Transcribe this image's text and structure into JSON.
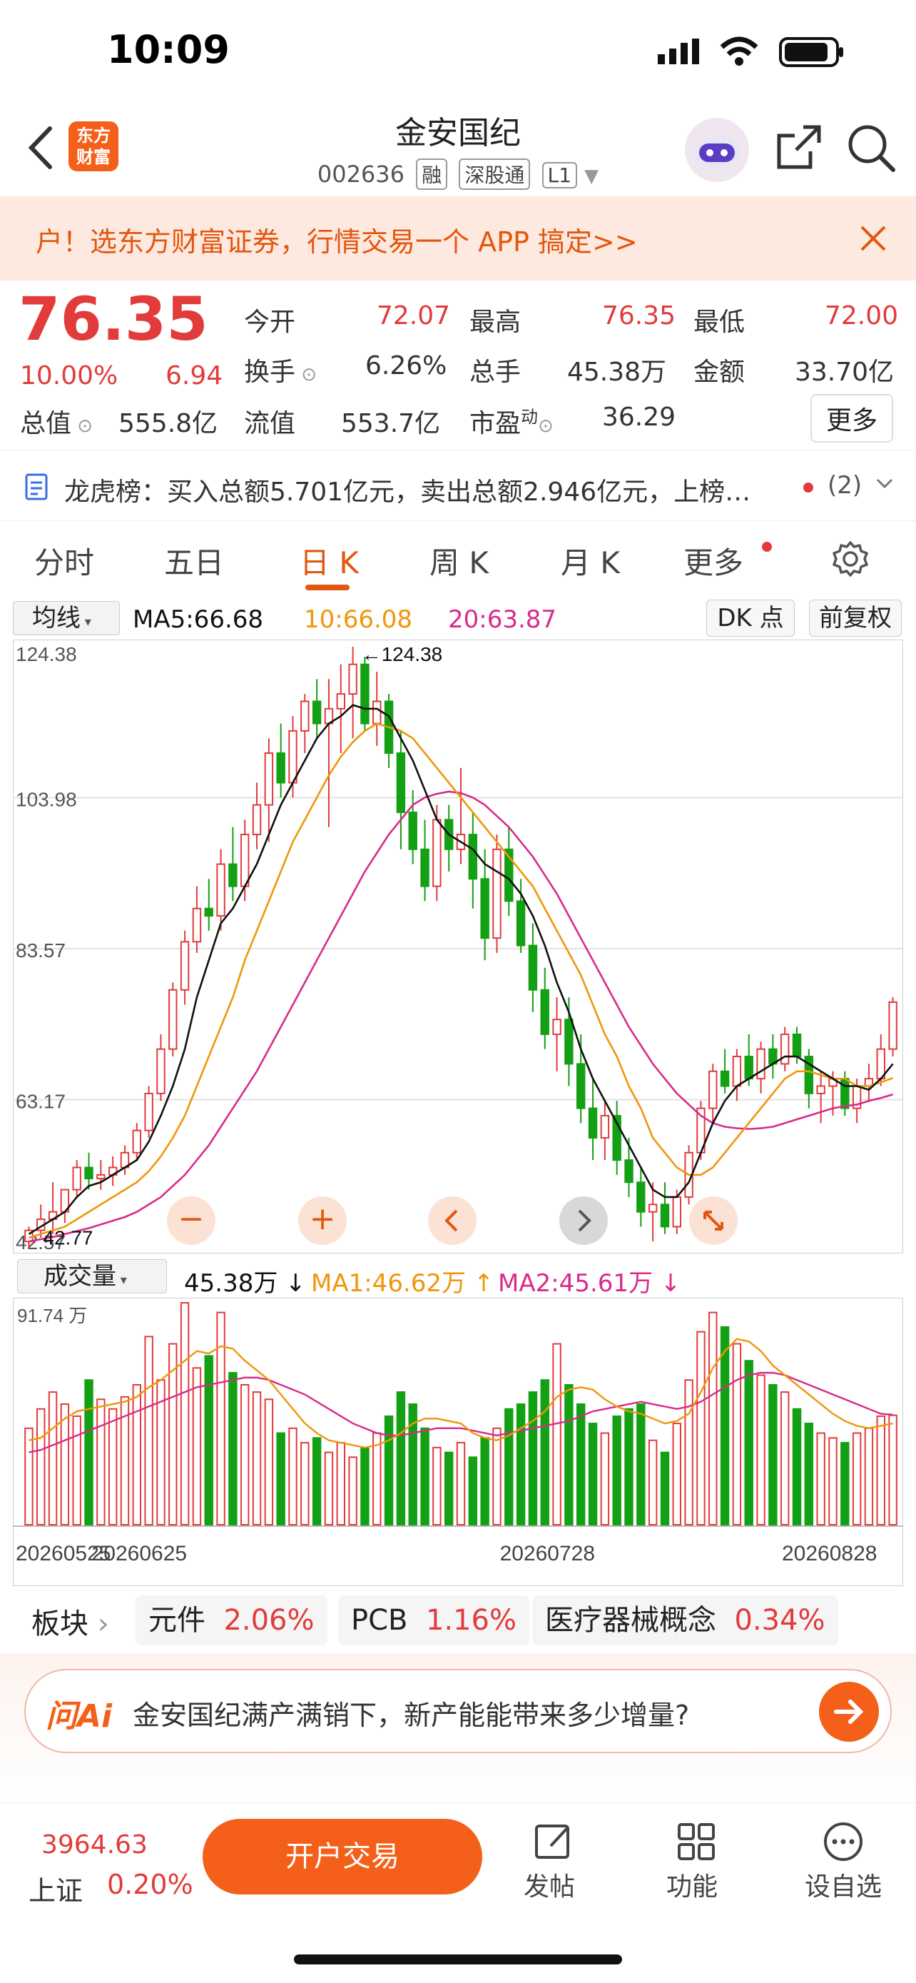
{
  "status": {
    "time": "10:09"
  },
  "header": {
    "brand_line1": "东方",
    "brand_line2": "财富",
    "title": "金安国纪",
    "code": "002636",
    "tags": [
      "融",
      "深股通",
      "L1"
    ]
  },
  "promo": {
    "text": "户！选东方财富证券，行情交易一个 APP 搞定>>"
  },
  "quote": {
    "price": "76.35",
    "change_pct": "10.00%",
    "change_amt": "6.94",
    "fields": [
      {
        "label": "今开",
        "value": "72.07"
      },
      {
        "label": "最高",
        "value": "76.35"
      },
      {
        "label": "最低",
        "value": "72.00"
      },
      {
        "label": "换手",
        "value": "6.26%"
      },
      {
        "label": "总手",
        "value": "45.38万"
      },
      {
        "label": "金额",
        "value": "33.70亿"
      },
      {
        "label": "总值",
        "value": "555.8亿"
      },
      {
        "label": "流值",
        "value": "553.7亿"
      },
      {
        "label": "市盈",
        "value": "36.29"
      }
    ],
    "pe_sup": "动",
    "more": "更多"
  },
  "lhb": {
    "text": "龙虎榜：买入总额5.701亿元，卖出总额2.946亿元，上榜…",
    "count": "(2)"
  },
  "tabs": [
    "分时",
    "五日",
    "日 K",
    "周 K",
    "月 K",
    "更多"
  ],
  "chart_controls": {
    "ma_selector": "均线",
    "ma5": "MA5:66.68",
    "ma10": "10:66.08",
    "ma20": "20:63.87",
    "dk": "DK 点",
    "adjust": "前复权",
    "vol_selector": "成交量",
    "vol_value": "45.38万",
    "vol_ma1": "MA1:46.62万",
    "vol_ma2": "MA2:45.61万",
    "vol_max": "91.74 万",
    "high_marker": "←124.38",
    "low_marker": "42.77"
  },
  "colors": {
    "up": "#e23b3b",
    "down": "#14a014",
    "ma5": "#111111",
    "ma10": "#f0960a",
    "ma20": "#d82b8a",
    "accent": "#f4601a"
  },
  "chart_data": {
    "type": "candlestick",
    "y_ticks": [
      "124.38",
      "103.98",
      "83.57",
      "63.17",
      "42.57"
    ],
    "ylim": [
      42.57,
      124.38
    ],
    "x_ticks": [
      "20260525",
      "20260625",
      "20260728",
      "20260828"
    ],
    "candles": [
      [
        44,
        46,
        43,
        45.5
      ],
      [
        45.5,
        49,
        44.5,
        47
      ],
      [
        47,
        52,
        45,
        48
      ],
      [
        48,
        51,
        46.5,
        51
      ],
      [
        51,
        55,
        50,
        54
      ],
      [
        54,
        56,
        51,
        52.5
      ],
      [
        52.5,
        55,
        51,
        53
      ],
      [
        53,
        55.5,
        51.5,
        54
      ],
      [
        54,
        57,
        53,
        56
      ],
      [
        56,
        60,
        55,
        59
      ],
      [
        59,
        65,
        58,
        64
      ],
      [
        64,
        72,
        63,
        70
      ],
      [
        70,
        79,
        69,
        78
      ],
      [
        78,
        86,
        76,
        84.5
      ],
      [
        84.5,
        92,
        83,
        89
      ],
      [
        89,
        93,
        86,
        88
      ],
      [
        88,
        97,
        86,
        95
      ],
      [
        95,
        100,
        90,
        92
      ],
      [
        92,
        101,
        90,
        99
      ],
      [
        99,
        106,
        97,
        103
      ],
      [
        103,
        112,
        98,
        110
      ],
      [
        110,
        114,
        104,
        106
      ],
      [
        106,
        115,
        104,
        113
      ],
      [
        113,
        118,
        110,
        117
      ],
      [
        117,
        120,
        112,
        114
      ],
      [
        114,
        120,
        100,
        116
      ],
      [
        116,
        122,
        110,
        118
      ],
      [
        118,
        124.38,
        112,
        122
      ],
      [
        122,
        123,
        113,
        114
      ],
      [
        114,
        121,
        111,
        117
      ],
      [
        117,
        118,
        108,
        110
      ],
      [
        110,
        113,
        97,
        102
      ],
      [
        102,
        105,
        95,
        97
      ],
      [
        97,
        101,
        90,
        92
      ],
      [
        92,
        103,
        90,
        101
      ],
      [
        101,
        103,
        94,
        97
      ],
      [
        97,
        108,
        95,
        99
      ],
      [
        99,
        102,
        89,
        93
      ],
      [
        93,
        97,
        82,
        85
      ],
      [
        85,
        99,
        83,
        97
      ],
      [
        97,
        100,
        88,
        90
      ],
      [
        90,
        93,
        83,
        84
      ],
      [
        84,
        87,
        75,
        78
      ],
      [
        78,
        81,
        70,
        72
      ],
      [
        72,
        77,
        67,
        74
      ],
      [
        74,
        77,
        65,
        68
      ],
      [
        68,
        72,
        60,
        62
      ],
      [
        62,
        66,
        55,
        58
      ],
      [
        58,
        63,
        55,
        61
      ],
      [
        61,
        63,
        53,
        55
      ],
      [
        55,
        58,
        50,
        52
      ],
      [
        52,
        54,
        46,
        48
      ],
      [
        48,
        52,
        44,
        49
      ],
      [
        49,
        52,
        45,
        46
      ],
      [
        46,
        51,
        45,
        50
      ],
      [
        50,
        57,
        49,
        56
      ],
      [
        56,
        63,
        55,
        62
      ],
      [
        62,
        68,
        60,
        67
      ],
      [
        67,
        70,
        64,
        65
      ],
      [
        65,
        70,
        63,
        69
      ],
      [
        69,
        72,
        65,
        66
      ],
      [
        66,
        71,
        64,
        70
      ],
      [
        70,
        72,
        66,
        68
      ],
      [
        68,
        73,
        67,
        72
      ],
      [
        72,
        73,
        68,
        69
      ],
      [
        69,
        70,
        62,
        64
      ],
      [
        64,
        67,
        60,
        65
      ],
      [
        65,
        67,
        61,
        66
      ],
      [
        66,
        67,
        61,
        62
      ],
      [
        62,
        66,
        60,
        65
      ],
      [
        65,
        68,
        63,
        66
      ],
      [
        66,
        72,
        65,
        70
      ],
      [
        70,
        77,
        69,
        76.35
      ]
    ],
    "ma5": [
      45,
      46,
      47,
      48,
      50,
      51.5,
      52,
      53,
      54,
      55,
      57.5,
      61,
      65,
      70,
      77,
      82,
      87,
      89,
      92,
      95,
      99,
      103,
      106,
      109,
      112,
      114,
      115,
      116.5,
      116,
      116,
      115,
      112,
      109,
      105,
      101,
      99,
      98,
      97,
      95,
      94,
      93,
      91,
      88,
      84,
      79,
      75,
      70,
      66,
      63,
      60,
      57,
      54,
      51,
      50,
      50,
      52,
      56,
      60,
      63,
      65,
      66,
      67,
      68,
      69,
      69,
      68,
      67,
      66,
      65,
      65,
      64.5,
      66,
      68
    ],
    "ma10": [
      44.5,
      45,
      45.5,
      46,
      47,
      48,
      49,
      50,
      51,
      52,
      53.5,
      55.5,
      58,
      61,
      65,
      69,
      73,
      77,
      82,
      86,
      90,
      94,
      98,
      101,
      104,
      107,
      109.5,
      111.5,
      113,
      114,
      113.5,
      113,
      112,
      110,
      108,
      106,
      104,
      102,
      100,
      98,
      96,
      94,
      92,
      89,
      86,
      83,
      80,
      76,
      72,
      69,
      65,
      62,
      58,
      56,
      54,
      53,
      53,
      54,
      56,
      58,
      60,
      62,
      64,
      66,
      67,
      67,
      66.5,
      66,
      66,
      65,
      65,
      65.5,
      66.1
    ],
    "ma20": [
      44,
      44.3,
      44.6,
      45,
      45.4,
      45.8,
      46.3,
      46.8,
      47.3,
      48,
      49,
      50,
      51.5,
      53,
      55,
      57,
      59.5,
      62,
      64.5,
      67,
      70,
      73,
      76,
      79,
      82,
      85,
      88,
      91,
      94,
      96.5,
      99,
      101,
      103,
      104,
      104.5,
      104.8,
      104.6,
      104,
      103,
      101.5,
      100,
      98,
      96,
      93.5,
      91,
      88,
      85,
      82,
      79,
      76,
      73,
      70.5,
      68,
      66,
      64,
      62.5,
      61,
      60,
      59.5,
      59.3,
      59.2,
      59.3,
      59.5,
      60,
      60.5,
      61,
      61.5,
      62,
      62.3,
      62.5,
      63,
      63.4,
      63.87
    ]
  },
  "volume_chart": {
    "volumes": [
      40,
      48,
      55,
      50,
      45,
      60,
      52,
      48,
      53,
      58,
      78,
      60,
      75,
      92,
      65,
      70,
      88,
      63,
      58,
      55,
      52,
      38,
      40,
      34,
      36,
      30,
      34,
      28,
      32,
      38,
      45,
      55,
      50,
      40,
      32,
      30,
      34,
      28,
      36,
      40,
      48,
      50,
      55,
      60,
      75,
      58,
      50,
      42,
      38,
      45,
      48,
      50,
      35,
      30,
      42,
      60,
      80,
      88,
      82,
      75,
      68,
      62,
      58,
      55,
      48,
      42,
      38,
      36,
      34,
      38,
      40,
      45,
      45.38
    ],
    "ma1": [
      35,
      36,
      40,
      44,
      47,
      48,
      49,
      50,
      51,
      53,
      57,
      60,
      64,
      68,
      72,
      71,
      74,
      73,
      68,
      64,
      60,
      54,
      48,
      42,
      38,
      35,
      34,
      33,
      32,
      33,
      35,
      38,
      42,
      44,
      44,
      43,
      42,
      38,
      36,
      35,
      37,
      40,
      43,
      47,
      53,
      56,
      57,
      56,
      52,
      49,
      47,
      46,
      44,
      42,
      43,
      46,
      55,
      65,
      72,
      77,
      76,
      72,
      66,
      62,
      58,
      54,
      50,
      46,
      43,
      41,
      40,
      41,
      42
    ],
    "ma2": [
      30,
      31,
      33,
      35,
      37,
      39,
      41,
      43,
      45,
      47,
      49,
      51,
      53,
      55,
      57,
      58,
      59,
      60,
      61,
      61,
      60,
      58,
      56,
      54,
      51,
      48,
      45,
      42,
      40,
      38,
      37,
      37,
      38,
      39,
      40,
      40,
      40,
      39,
      38,
      37,
      38,
      39,
      40,
      41,
      42,
      43,
      45,
      47,
      48,
      49,
      50,
      51,
      50,
      49,
      48,
      49,
      51,
      54,
      57,
      60,
      62,
      63,
      63,
      62,
      60,
      58,
      56,
      54,
      52,
      50,
      48,
      46,
      45.61
    ]
  },
  "sectors": {
    "label": "板块",
    "items": [
      {
        "name": "元件",
        "pct": "2.06%"
      },
      {
        "name": "PCB",
        "pct": "1.16%"
      },
      {
        "name": "医疗器械概念",
        "pct": "0.34%"
      }
    ]
  },
  "ask": {
    "brand": "问Ai",
    "text": "金安国纪满产满销下，新产能能带来多少增量?"
  },
  "bottom": {
    "index_value": "3964.63",
    "index_name": "上证",
    "index_pct": "0.20%",
    "cta": "开户交易",
    "items": [
      "发帖",
      "功能",
      "设自选"
    ]
  }
}
